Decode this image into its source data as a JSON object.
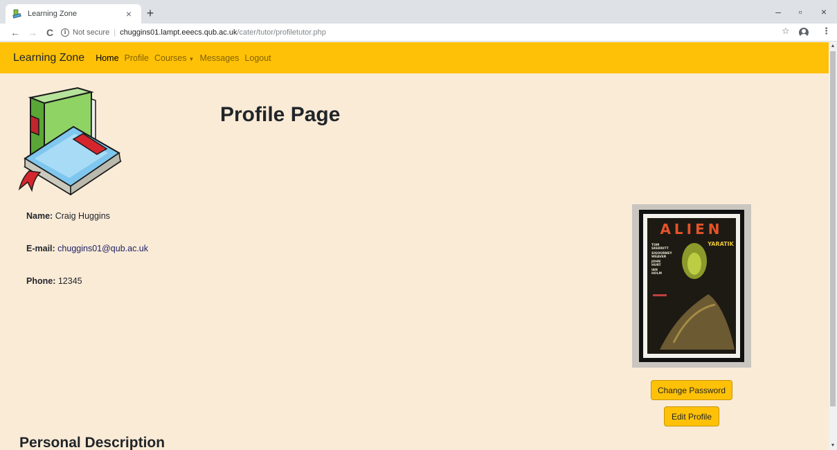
{
  "browser": {
    "tab_title": "Learning Zone",
    "tab_close": "×",
    "new_tab": "+",
    "window_minimize": "–",
    "window_restore": "▫",
    "window_close": "×",
    "back": "←",
    "forward": "→",
    "reload": "C",
    "security_label": "Not secure",
    "separator": "|",
    "url_host": "chuggins01.lampt.eeecs.qub.ac.uk",
    "url_path": "/cater/tutor/profiletutor.php",
    "bookmark": "☆",
    "menu": "⋮"
  },
  "navbar": {
    "brand": "Learning Zone",
    "links": [
      "Home",
      "Profile",
      "Courses",
      "Messages",
      "Logout"
    ],
    "active": "Home"
  },
  "page": {
    "title": "Profile Page",
    "name_label": "Name:",
    "name_value": "Craig Huggins",
    "email_label": "E-mail:",
    "email_value": "chuggins01@qub.ac.uk",
    "phone_label": "Phone:",
    "phone_value": "12345",
    "change_password": "Change Password",
    "edit_profile": "Edit Profile",
    "section_heading": "Personal Description"
  },
  "poster": {
    "title": "ALIEN",
    "tag": "YARATIK",
    "cast": [
      "TOM",
      "SKERRITT",
      "SIGOURNEY",
      "WEAVER",
      "JOHN",
      "HURT",
      "IAN",
      "HOLM"
    ]
  },
  "colors": {
    "navbar_bg": "#ffc107",
    "page_bg": "#faebd7",
    "button_bg": "#ffc107"
  },
  "icons": {
    "favicon": "book-favicon-icon",
    "info": "info-icon",
    "star": "star-icon",
    "profile": "account-circle-icon",
    "caret": "caret-down-icon"
  }
}
